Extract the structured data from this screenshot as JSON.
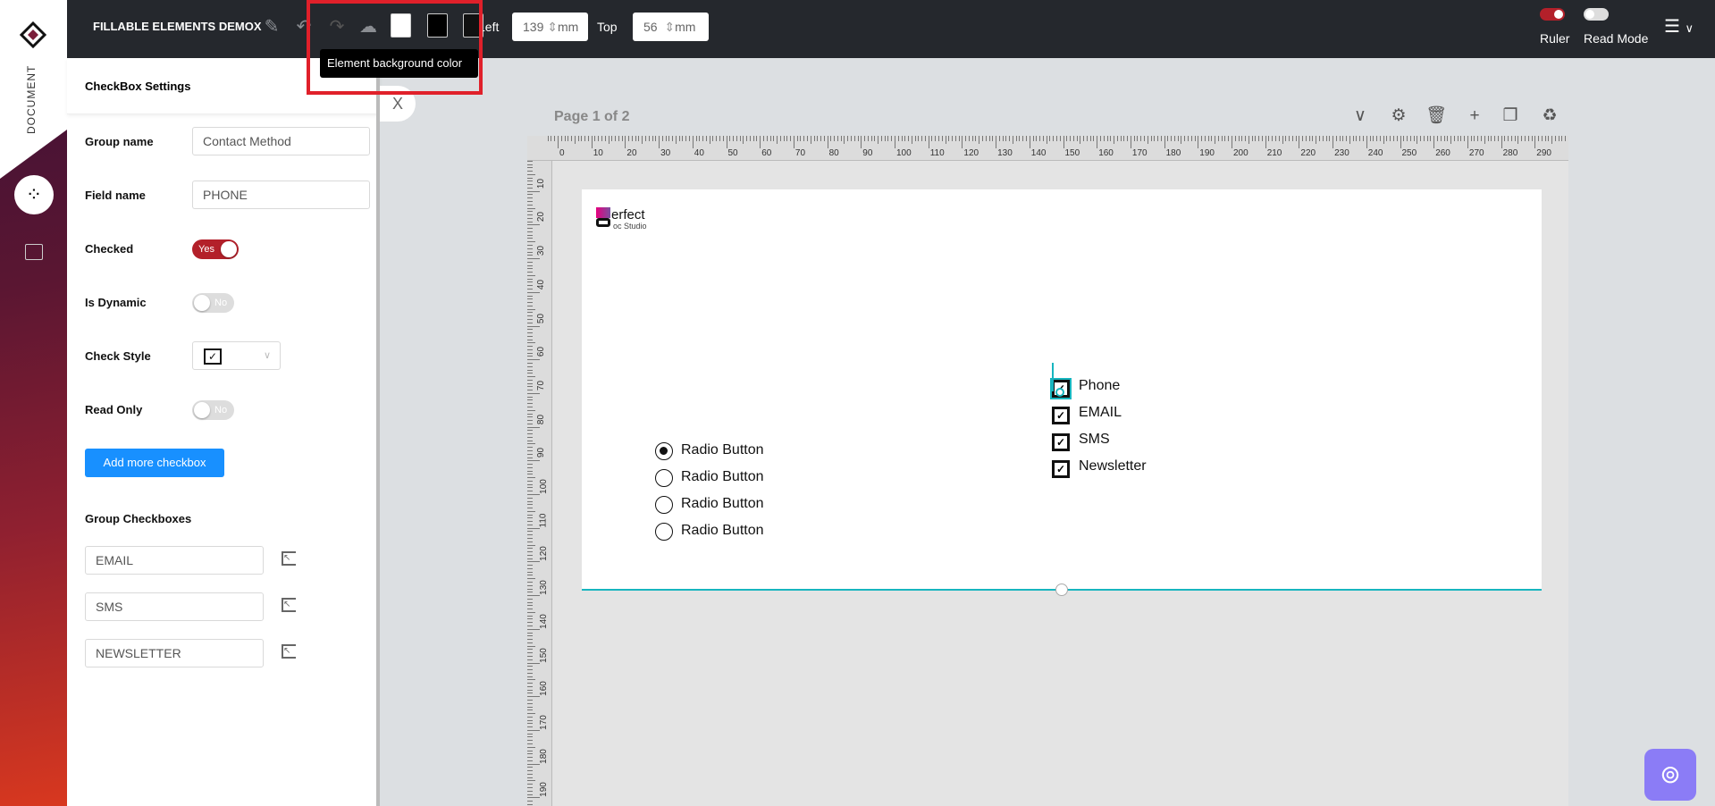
{
  "sidebar": {
    "section_label": "DOCUMENT",
    "items": [
      {
        "icon": "elements-icon",
        "active": true
      },
      {
        "icon": "image-icon",
        "active": false
      }
    ]
  },
  "topbar": {
    "title": "FILLABLE ELEMENTS DEMOX",
    "left_label": "Left",
    "left_value": "139",
    "left_unit": "mm",
    "top_label": "Top",
    "top_value": "56",
    "top_unit": "mm",
    "tooltip": "Element background color",
    "swatches": [
      "#ffffff",
      "#000000",
      "#111111"
    ],
    "ruler_label": "Ruler",
    "ruler_on": true,
    "readmode_label": "Read Mode",
    "readmode_on": false
  },
  "panel": {
    "title": "CheckBox Settings",
    "close": "X",
    "group_name_label": "Group name",
    "group_name_value": "Contact Method",
    "field_name_label": "Field name",
    "field_name_value": "PHONE",
    "checked_label": "Checked",
    "checked_value": "Yes",
    "dynamic_label": "Is Dynamic",
    "dynamic_value": "No",
    "style_label": "Check Style",
    "style_value": "✓",
    "readonly_label": "Read Only",
    "readonly_value": "No",
    "add_button": "Add more checkbox",
    "group_title": "Group Checkboxes",
    "group_items": [
      "EMAIL",
      "SMS",
      "NEWSLETTER"
    ]
  },
  "page": {
    "indicator": "Page 1 of 2",
    "logo_text": "erfect",
    "logo_sub": "oc Studio",
    "radios": [
      "Radio Button",
      "Radio Button",
      "Radio Button",
      "Radio Button"
    ],
    "radio_selected": 0,
    "checkboxes": [
      "Phone",
      "EMAIL",
      "SMS",
      "Newsletter"
    ]
  },
  "ruler": {
    "top": [
      "0",
      "10",
      "20",
      "30",
      "40",
      "50",
      "60",
      "70",
      "80",
      "90",
      "100",
      "110",
      "120",
      "130",
      "140",
      "150",
      "160",
      "170",
      "180",
      "190",
      "200",
      "210",
      "220",
      "230",
      "240",
      "250",
      "260",
      "270",
      "280",
      "290"
    ],
    "left": [
      "10",
      "20",
      "30",
      "40",
      "50",
      "60",
      "70",
      "80",
      "90",
      "100",
      "110",
      "120",
      "130",
      "140",
      "150",
      "160",
      "170",
      "180",
      "190"
    ]
  },
  "colors": {
    "accent": "#b3202a",
    "teal": "#17b5bf",
    "button": "#1890ff",
    "help": "#8b7cf6"
  }
}
